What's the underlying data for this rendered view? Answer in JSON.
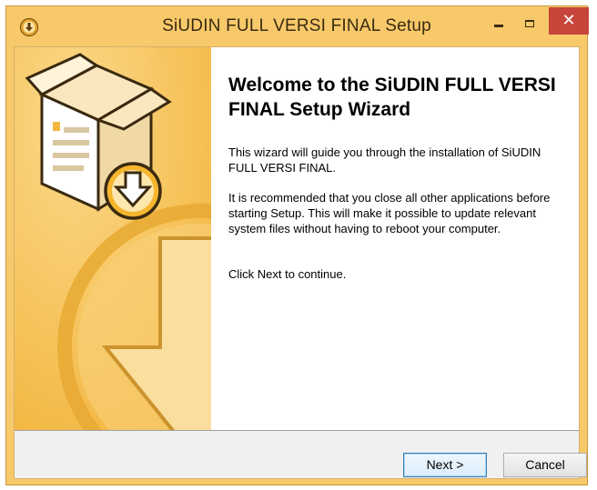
{
  "window": {
    "title": "SiUDIN FULL VERSI FINAL Setup",
    "controls": {
      "minimize": "minimize",
      "maximize": "maximize",
      "close": "✕"
    }
  },
  "banner": {
    "icons": [
      "package-box-icon",
      "download-arrow-icon",
      "large-download-arrow-icon"
    ]
  },
  "content": {
    "heading": "Welcome to the SiUDIN FULL VERSI FINAL Setup Wizard",
    "paragraphs": [
      "This wizard will guide you through the installation of SiUDIN FULL VERSI FINAL.",
      "It is recommended that you close all other applications before starting Setup. This will make it possible to update relevant system files without having to reboot your computer.",
      "Click Next to continue."
    ]
  },
  "buttons": {
    "next": "Next >",
    "cancel": "Cancel"
  },
  "colors": {
    "titlebar": "#f8c96a",
    "close": "#c7453a",
    "banner": "#f7c45a"
  }
}
